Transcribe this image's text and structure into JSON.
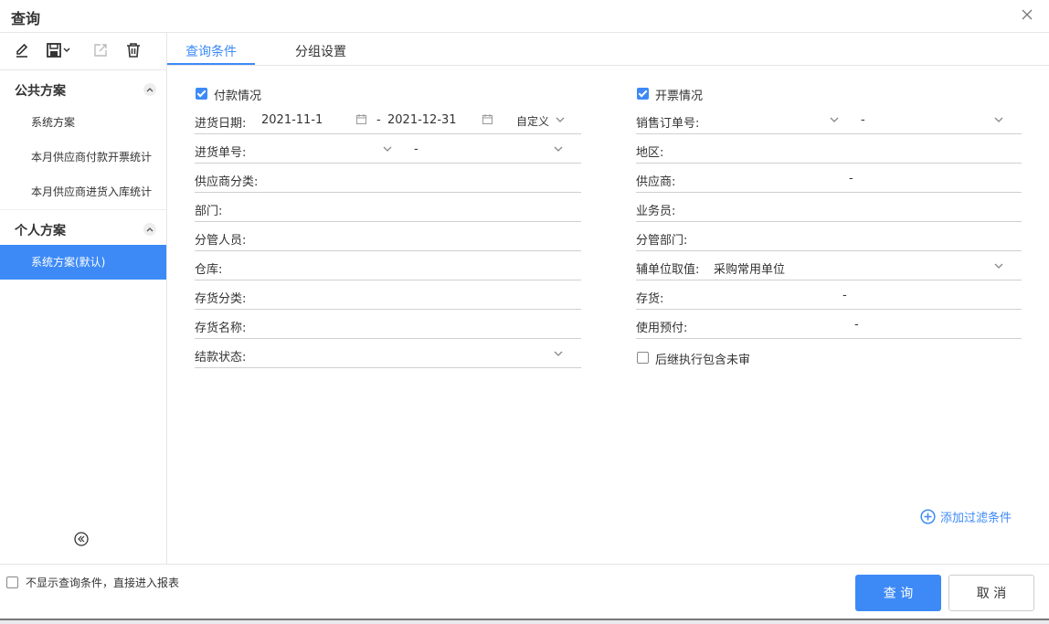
{
  "window": {
    "title": "查询"
  },
  "sidebar": {
    "toolbar": [
      "edit-icon",
      "save-icon",
      "export-icon",
      "delete-icon"
    ],
    "groups": [
      {
        "label": "公共方案",
        "items": [
          "系统方案",
          "本月供应商付款开票统计",
          "本月供应商进货入库统计"
        ]
      },
      {
        "label": "个人方案",
        "items": [
          "系统方案(默认)"
        ]
      }
    ],
    "active_item": "系统方案(默认)"
  },
  "tabs": [
    {
      "label": "查询条件",
      "active": true
    },
    {
      "label": "分组设置",
      "active": false
    }
  ],
  "left": {
    "section_label": "付款情况",
    "section_checked": true,
    "date_label": "进货日期:",
    "date_from": "2021-11-1",
    "date_sep": "-",
    "date_to": "2021-12-31",
    "date_mode": "自定义",
    "fields": [
      {
        "label": "进货单号:",
        "range_sep": "-"
      },
      {
        "label": "供应商分类:"
      },
      {
        "label": "部门:"
      },
      {
        "label": "分管人员:"
      },
      {
        "label": "仓库:"
      },
      {
        "label": "存货分类:"
      },
      {
        "label": "存货名称:"
      },
      {
        "label": "结款状态:"
      }
    ]
  },
  "right": {
    "section_label": "开票情况",
    "section_checked": true,
    "fields": [
      {
        "label": "销售订单号:",
        "range_sep": "-"
      },
      {
        "label": "地区:"
      },
      {
        "label": "供应商:",
        "range_sep": "-"
      },
      {
        "label": "业务员:"
      },
      {
        "label": "分管部门:"
      },
      {
        "label": "辅单位取值:",
        "value": "采购常用单位"
      },
      {
        "label": "存货:",
        "range_sep": "-"
      },
      {
        "label": "使用预付:",
        "range_sep": "-"
      }
    ],
    "include_unaudited_label": "后继执行包含未审",
    "include_unaudited_checked": false
  },
  "add_filter_label": "添加过滤条件",
  "footer": {
    "skip_label": "不显示查询条件，直接进入报表",
    "skip_checked": false,
    "query_label": "查 询",
    "cancel_label": "取 消"
  },
  "colors": {
    "accent": "#3d8af7",
    "border": "#cfcfcf"
  }
}
